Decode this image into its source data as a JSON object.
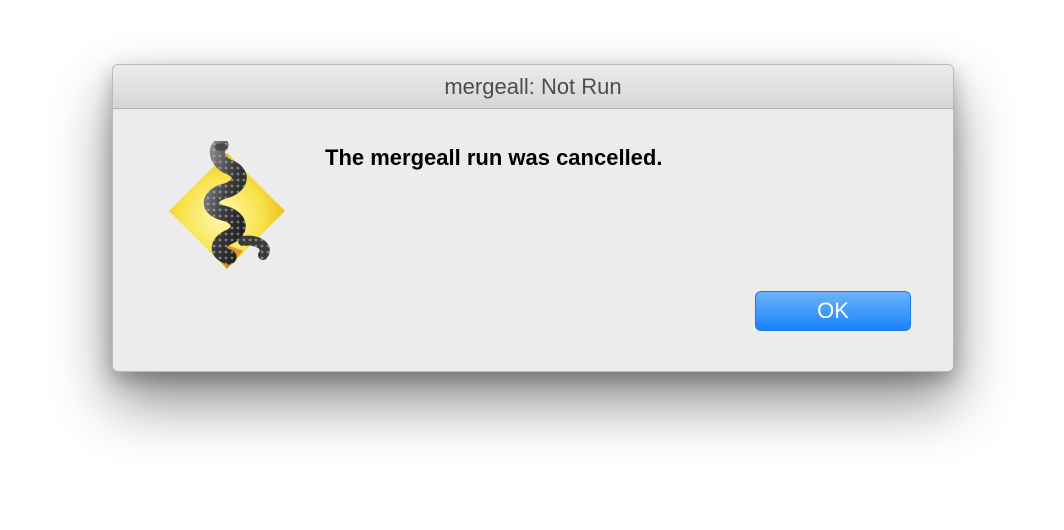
{
  "window": {
    "title": "mergeall: Not Run"
  },
  "dialog": {
    "icon": "python-snake-app-icon",
    "message": "The mergeall run was cancelled.",
    "ok_label": "OK"
  },
  "colors": {
    "button_accent": "#1a82fb",
    "dialog_background": "#ececec",
    "icon_diamond": "#f5d417"
  }
}
